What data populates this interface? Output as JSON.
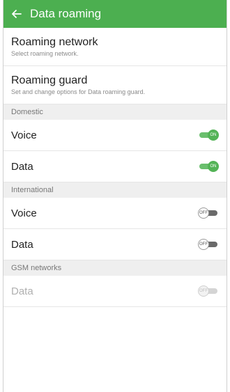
{
  "appbar": {
    "title": "Data roaming"
  },
  "roaming_network": {
    "title": "Roaming network",
    "summary": "Select roaming network."
  },
  "roaming_guard": {
    "title": "Roaming guard",
    "summary": "Set and change options for Data roaming guard."
  },
  "domestic": {
    "header": "Domestic",
    "voice": {
      "label": "Voice",
      "state": "ON"
    },
    "data": {
      "label": "Data",
      "state": "ON"
    }
  },
  "international": {
    "header": "International",
    "voice": {
      "label": "Voice",
      "state": "OFF"
    },
    "data": {
      "label": "Data",
      "state": "OFF"
    }
  },
  "gsm": {
    "header": "GSM networks",
    "data": {
      "label": "Data",
      "state": "OFF"
    }
  }
}
